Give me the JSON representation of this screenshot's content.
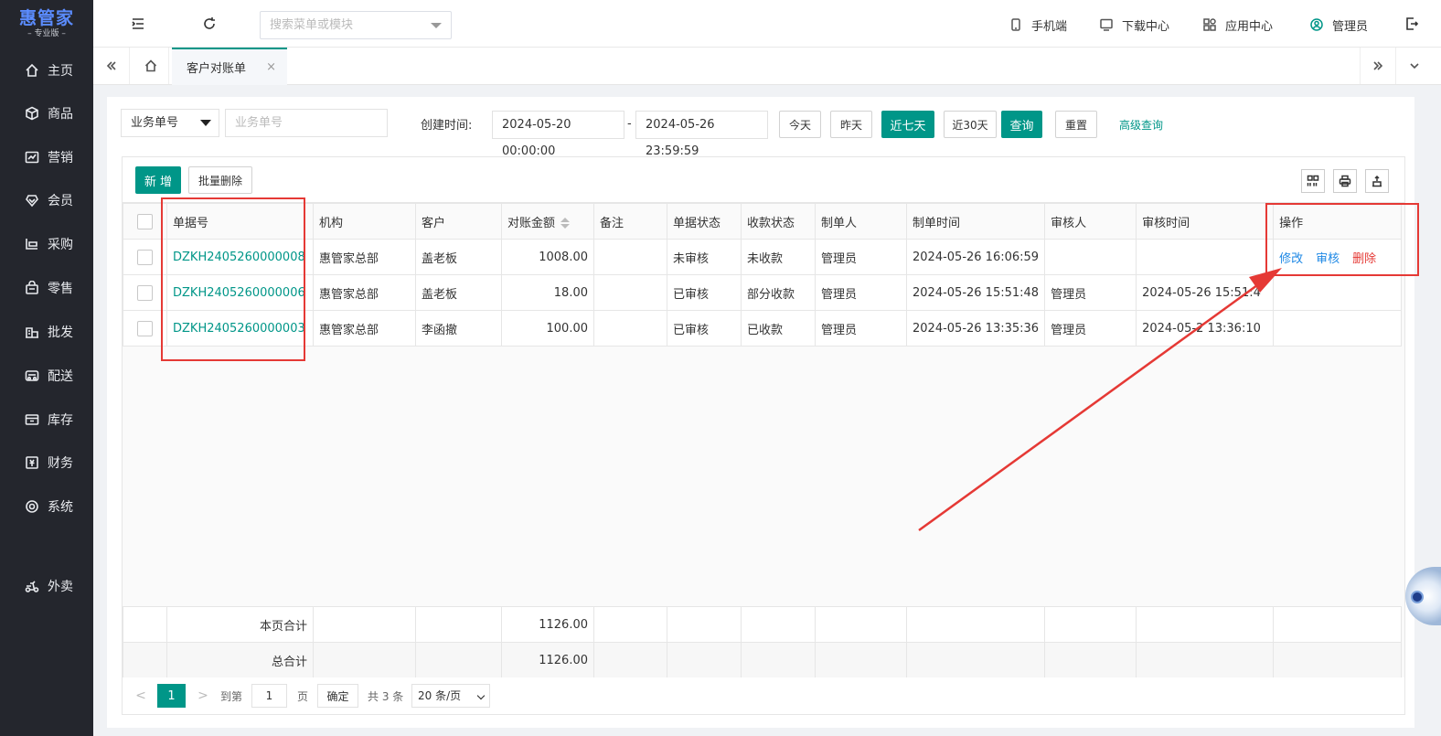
{
  "app": {
    "logo": "惠管家",
    "edition": "专业版"
  },
  "sidebar": {
    "items": [
      {
        "label": "主页",
        "icon": "home-icon"
      },
      {
        "label": "商品",
        "icon": "box-icon"
      },
      {
        "label": "营销",
        "icon": "chart-icon"
      },
      {
        "label": "会员",
        "icon": "member-icon"
      },
      {
        "label": "采购",
        "icon": "purchase-icon"
      },
      {
        "label": "零售",
        "icon": "retail-icon"
      },
      {
        "label": "批发",
        "icon": "wholesale-icon"
      },
      {
        "label": "配送",
        "icon": "delivery-icon"
      },
      {
        "label": "库存",
        "icon": "inventory-icon"
      },
      {
        "label": "财务",
        "icon": "finance-icon"
      },
      {
        "label": "系统",
        "icon": "settings-icon"
      },
      {
        "label": "外卖",
        "icon": "takeaway-icon"
      }
    ]
  },
  "topbar": {
    "search_placeholder": "搜索菜单或模块",
    "mobile": "手机端",
    "download": "下载中心",
    "apps": "应用中心",
    "user": "管理员"
  },
  "tabs": {
    "active": "客户对账单",
    "close": "×"
  },
  "filters": {
    "field_select": "业务单号",
    "field_placeholder": "业务单号",
    "created_label": "创建时间:",
    "date_from": "2024-05-20 00:00:00",
    "date_sep": "-",
    "date_to": "2024-05-26 23:59:59",
    "today": "今天",
    "yesterday": "昨天",
    "last7": "近七天",
    "last30": "近30天",
    "query": "查询",
    "reset": "重置",
    "advanced": "高级查询"
  },
  "toolbar": {
    "add": "新 增",
    "batch_delete": "批量删除"
  },
  "table": {
    "headers": {
      "doc_no": "单据号",
      "org": "机构",
      "customer": "客户",
      "amount": "对账金额",
      "remark": "备注",
      "doc_status": "单据状态",
      "pay_status": "收款状态",
      "maker": "制单人",
      "make_time": "制单时间",
      "auditor": "审核人",
      "audit_time": "审核时间",
      "ops": "操作"
    },
    "rows": [
      {
        "doc_no": "DZKH2405260000008",
        "org": "惠管家总部",
        "customer": "盖老板",
        "amount": "1008.00",
        "remark": "",
        "doc_status": "未审核",
        "pay_status": "未收款",
        "maker": "管理员",
        "make_time": "2024-05-26 16:06:59",
        "auditor": "",
        "audit_time": ""
      },
      {
        "doc_no": "DZKH2405260000006",
        "org": "惠管家总部",
        "customer": "盖老板",
        "amount": "18.00",
        "remark": "",
        "doc_status": "已审核",
        "pay_status": "部分收款",
        "maker": "管理员",
        "make_time": "2024-05-26 15:51:48",
        "auditor": "管理员",
        "audit_time": "2024-05-26 15:51:4"
      },
      {
        "doc_no": "DZKH2405260000003",
        "org": "惠管家总部",
        "customer": "李函撤",
        "amount": "100.00",
        "remark": "",
        "doc_status": "已审核",
        "pay_status": "已收款",
        "maker": "管理员",
        "make_time": "2024-05-26 13:35:36",
        "auditor": "管理员",
        "audit_time": "2024-05-2 13:36:10"
      }
    ],
    "ops": {
      "edit": "修改",
      "audit": "审核",
      "delete": "删除"
    },
    "summary": {
      "page_total_label": "本页合计",
      "page_total": "1126.00",
      "grand_total_label": "总合计",
      "grand_total": "1126.00"
    }
  },
  "pager": {
    "prev": "<",
    "current": "1",
    "next": ">",
    "goto_label": "到第",
    "goto_value": "1",
    "page_unit": "页",
    "confirm": "确定",
    "total": "共 3 条",
    "page_size": "20 条/页"
  },
  "colors": {
    "accent": "#009688",
    "annotation": "#e53935",
    "link_blue": "#1e88e5",
    "sidebar_bg": "#24262d"
  }
}
